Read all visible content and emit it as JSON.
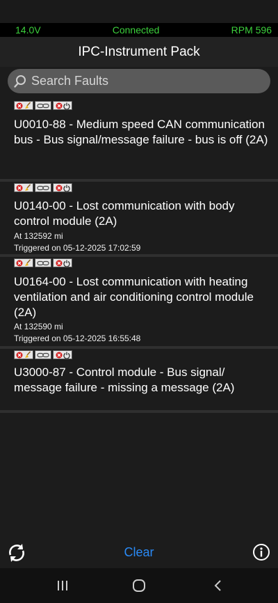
{
  "top_bar": {
    "voltage": "14.0V",
    "status": "Connected",
    "rpm": "RPM 596"
  },
  "header": {
    "title": "IPC-Instrument Pack"
  },
  "search": {
    "placeholder": "Search Faults"
  },
  "faults": [
    {
      "title": "U0010-88 - Medium speed CAN communication bus - Bus signal/message failure - bus is off (2A)",
      "mileage": "",
      "triggered": ""
    },
    {
      "title": "U0140-00 - Lost communication with body control module (2A)",
      "mileage": "At 132592 mi",
      "triggered": "Triggered on 05-12-2025 17:02:59"
    },
    {
      "title": "U0164-00 - Lost communication with heating ventilation and air conditioning control module (2A)",
      "mileage": "At 132590 mi",
      "triggered": "Triggered on 05-12-2025 16:55:48"
    },
    {
      "title": "U3000-87 - Control module - Bus signal/ message failure - missing a message (2A)",
      "mileage": "",
      "triggered": ""
    }
  ],
  "bottom_bar": {
    "clear_label": "Clear",
    "refresh_icon": "refresh-icon",
    "info_icon": "info-icon"
  },
  "colors": {
    "accent": "#2a8af6",
    "status_green": "#3cd03c",
    "error_red": "#d41e1e"
  }
}
